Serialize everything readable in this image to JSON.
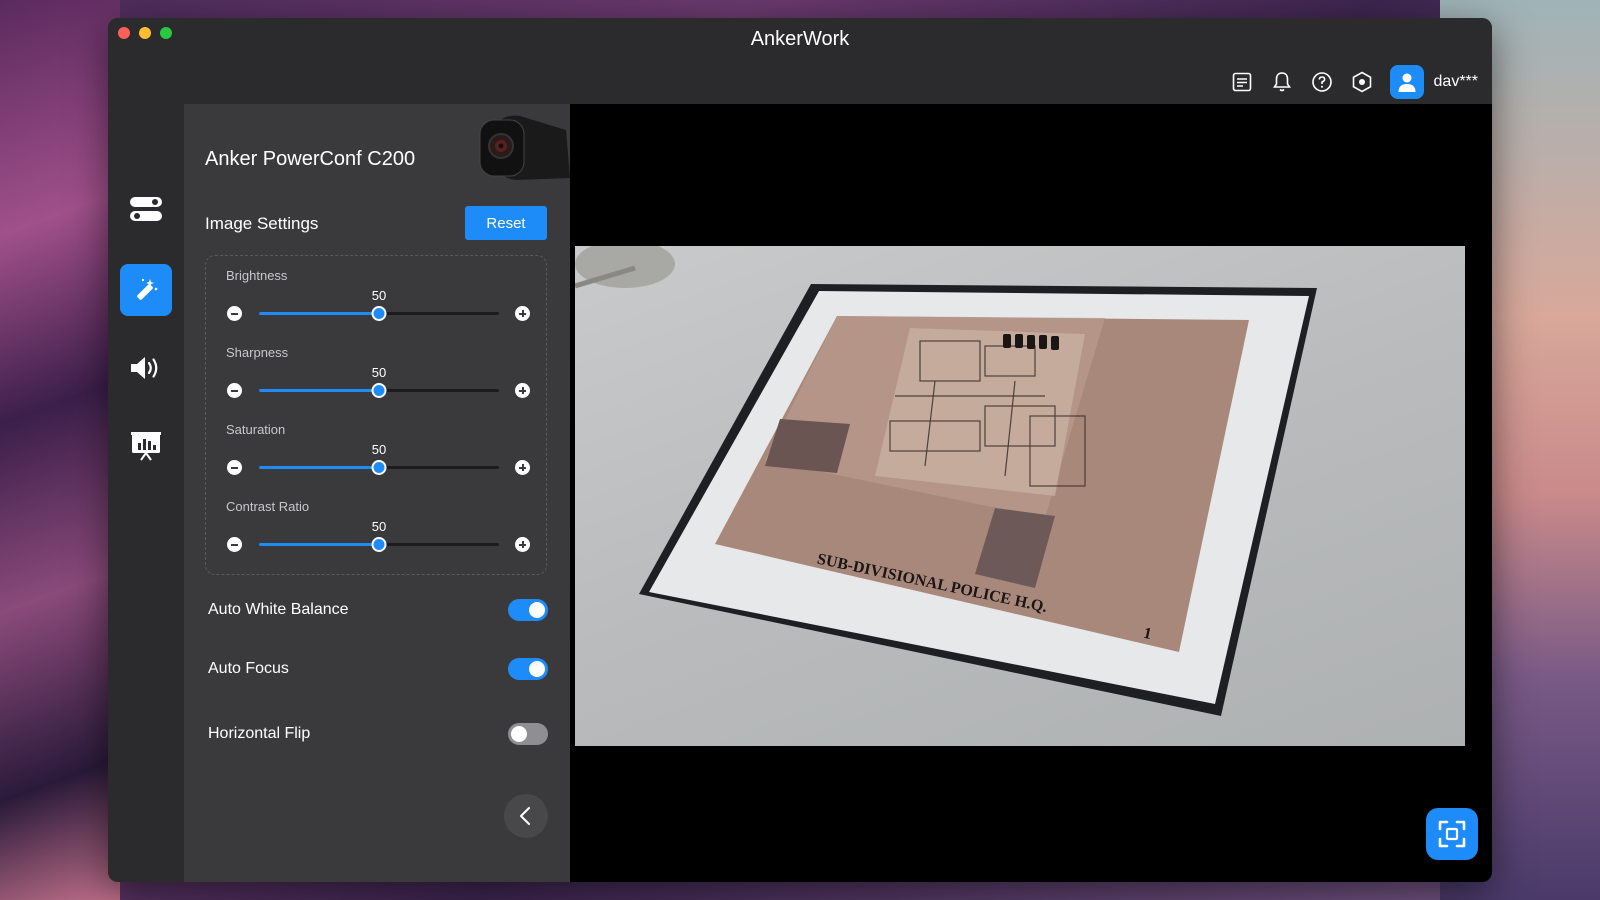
{
  "window": {
    "title": "AnkerWork"
  },
  "toolbar": {
    "icons": [
      "log-icon",
      "bell-icon",
      "help-icon",
      "settings-hex-icon"
    ],
    "username": "dav***"
  },
  "rail": {
    "items": [
      {
        "name": "controls",
        "icon": "toggles-icon",
        "active": false
      },
      {
        "name": "image",
        "icon": "magic-wand-icon",
        "active": true
      },
      {
        "name": "audio",
        "icon": "speaker-icon",
        "active": false
      },
      {
        "name": "presentation",
        "icon": "presentation-chart-icon",
        "active": false
      }
    ]
  },
  "panel": {
    "device_name": "Anker PowerConf C200",
    "section_title": "Image Settings",
    "reset_label": "Reset",
    "sliders": [
      {
        "label": "Brightness",
        "value": "50",
        "fraction": 0.5
      },
      {
        "label": "Sharpness",
        "value": "50",
        "fraction": 0.5
      },
      {
        "label": "Saturation",
        "value": "50",
        "fraction": 0.5
      },
      {
        "label": "Contrast Ratio",
        "value": "50",
        "fraction": 0.5
      }
    ],
    "toggles": [
      {
        "label": "Auto White Balance",
        "on": true
      },
      {
        "label": "Auto Focus",
        "on": true
      },
      {
        "label": "Horizontal Flip",
        "on": false
      }
    ]
  },
  "preview": {
    "caption_in_image": "SUB-DIVISIONAL POLICE H.Q.",
    "page_number_in_image": "1"
  },
  "colors": {
    "accent": "#1d8cf8",
    "panel": "#3a3a3c",
    "window": "#2b2b2d"
  }
}
